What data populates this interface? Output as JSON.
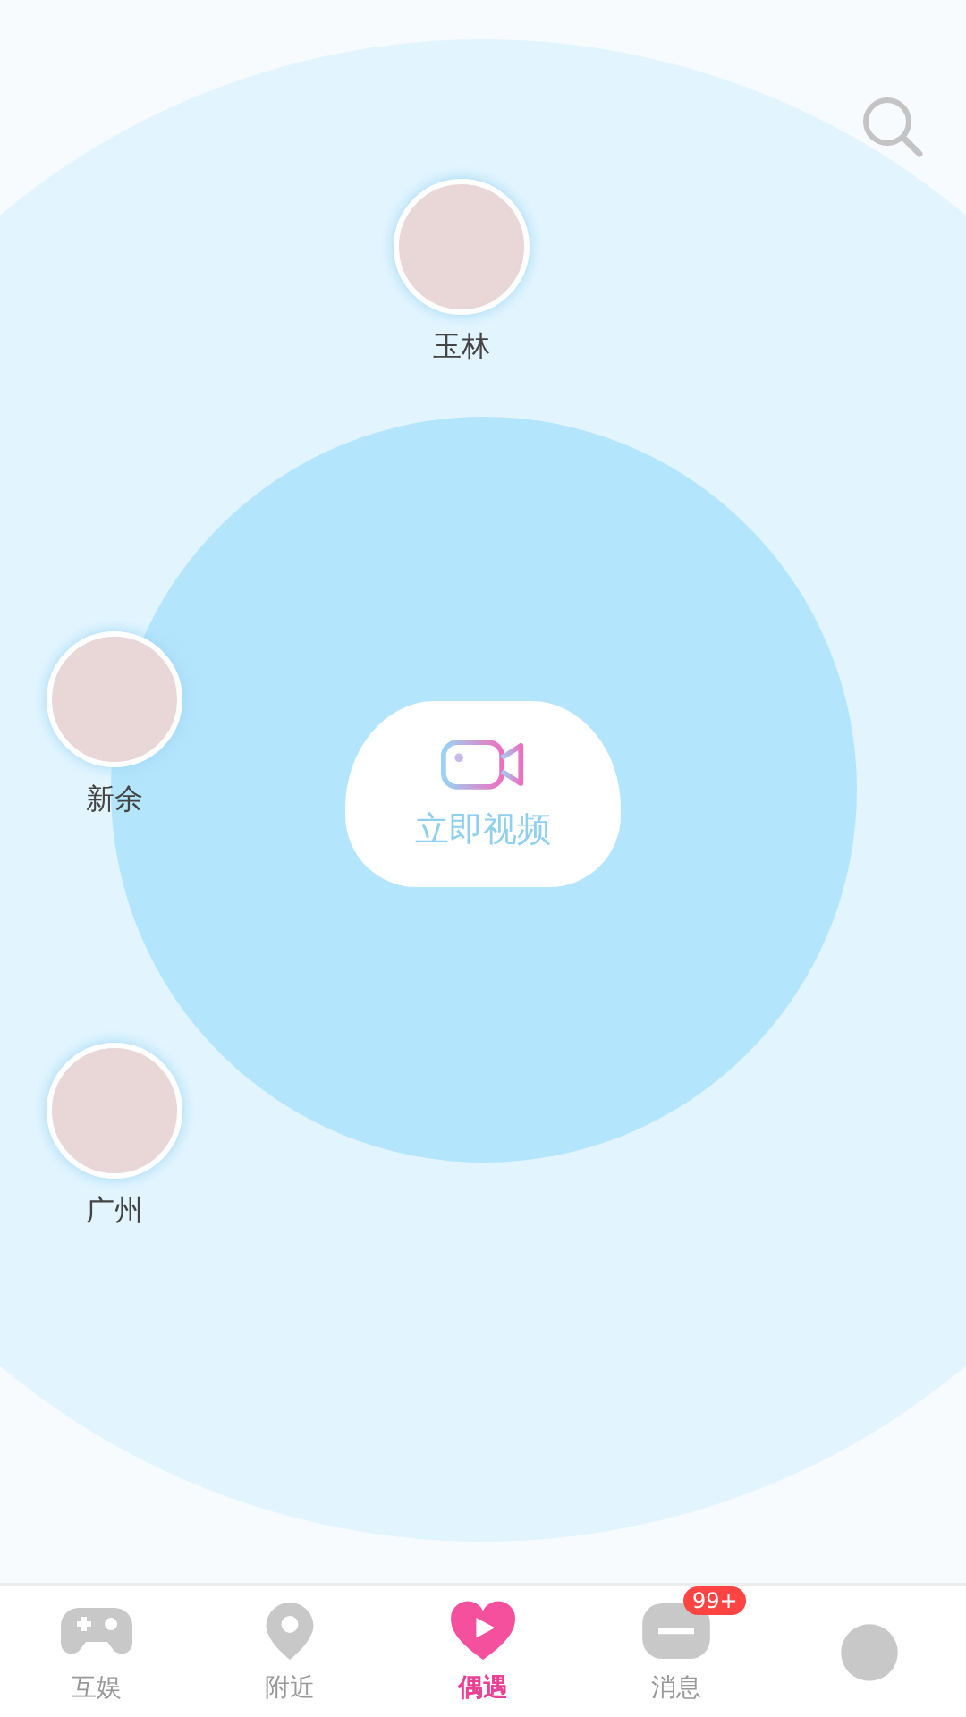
{
  "users": [
    {
      "city": "玉林"
    },
    {
      "city": "新余"
    },
    {
      "city": "广州"
    }
  ],
  "video_button": {
    "label": "立即视频"
  },
  "tabs": [
    {
      "label": "互娱",
      "selected": false
    },
    {
      "label": "附近",
      "selected": false
    },
    {
      "label": "偶遇",
      "selected": true
    },
    {
      "label": "消息",
      "selected": false,
      "badge": "99+"
    }
  ]
}
